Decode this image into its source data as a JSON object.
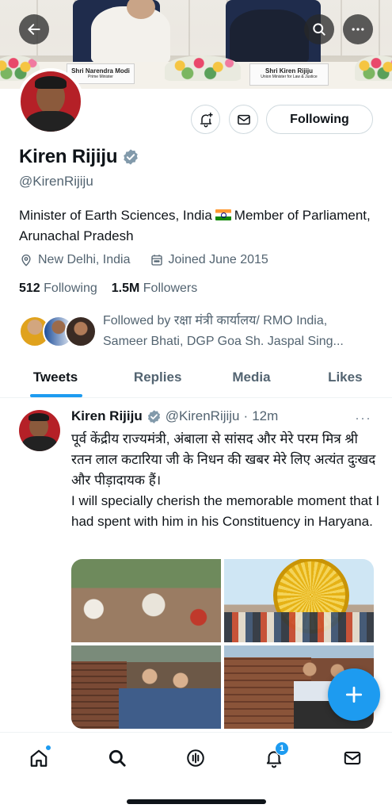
{
  "banner": {
    "namecard_left_name": "Shri Narendra Modi",
    "namecard_left_title": "Prime Minister",
    "namecard_right_name": "Shri Kiren Rijiju",
    "namecard_right_title": "Union Minister for Law & Justice"
  },
  "top_bar": {
    "back_icon": "arrow-left-icon",
    "search_icon": "search-icon",
    "more_icon": "more-horizontal-icon"
  },
  "profile": {
    "name": "Kiren Rijiju",
    "handle": "@KirenRijiju",
    "bio_part1": "Minister of Earth Sciences, India",
    "bio_part2": "Member of Parliament, Arunachal Pradesh",
    "location": "New Delhi, India",
    "joined": "Joined June 2015",
    "following_count": "512",
    "following_label": "Following",
    "followers_count": "1.5M",
    "followers_label": "Followers",
    "followed_by": "Followed by रक्षा मंत्री कार्यालय/ RMO India, Sameer Bhati, DGP Goa Sh. Jaspal Sing...",
    "follow_button_label": "Following",
    "verified_color": "#829aab"
  },
  "tabs": [
    {
      "label": "Tweets",
      "active": true
    },
    {
      "label": "Replies",
      "active": false
    },
    {
      "label": "Media",
      "active": false
    },
    {
      "label": "Likes",
      "active": false
    }
  ],
  "tweet": {
    "author_name": "Kiren Rijiju",
    "author_handle": "@KirenRijiju",
    "separator": "·",
    "time": "12m",
    "more": "···",
    "text_line1": "पूर्व केंद्रीय राज्यमंत्री, अंबाला से सांसद और मेरे परम मित्र श्री रतन लाल कटारिया जी के निधन की खबर मेरे लिए अत्यंत दुःखद और पीड़ादायक हैं।",
    "text_line2": "I will specially cherish the memorable moment that I had spent with him in his Constituency in Haryana.",
    "media_count": 4
  },
  "fab": {
    "icon": "plus-icon"
  },
  "bottom_nav": {
    "items": [
      "home-icon",
      "search-icon",
      "spaces-icon",
      "notifications-icon",
      "messages-icon"
    ],
    "notification_badge": "1"
  },
  "colors": {
    "accent": "#1d9bf0",
    "text_primary": "#0f1419",
    "text_secondary": "#536471"
  }
}
